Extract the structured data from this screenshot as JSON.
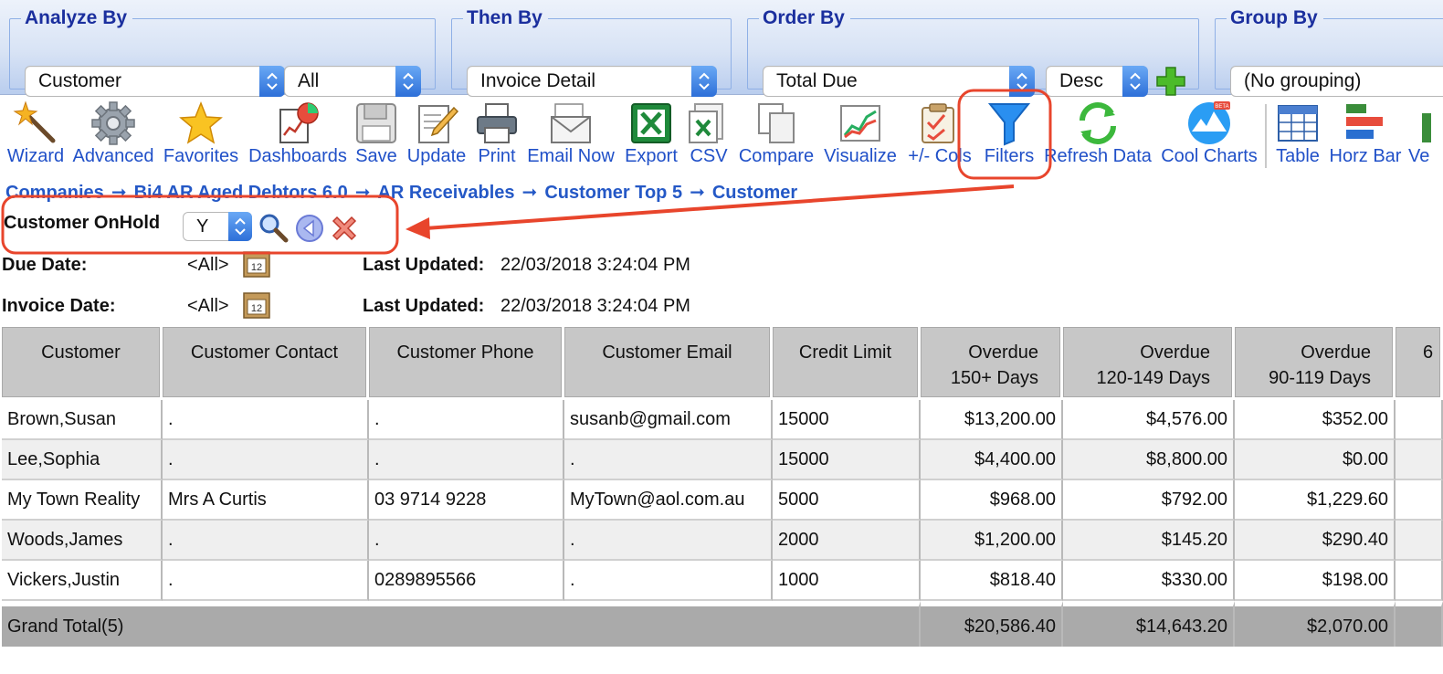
{
  "analyze_bar": {
    "analyze_by": {
      "label": "Analyze By",
      "value": "Customer",
      "scope": "All"
    },
    "then_by": {
      "label": "Then By",
      "value": "Invoice Detail"
    },
    "order_by": {
      "label": "Order By",
      "value": "Total Due",
      "direction": "Desc"
    },
    "group_by": {
      "label": "Group By",
      "value": "(No grouping)"
    }
  },
  "toolbar": [
    {
      "label": "Wizard",
      "icon": "wand-icon"
    },
    {
      "label": "Advanced",
      "icon": "gear-icon"
    },
    {
      "label": "Favorites",
      "icon": "star-icon"
    },
    {
      "label": "Dashboards",
      "icon": "dashboard-icon"
    },
    {
      "label": "Save",
      "icon": "floppy-icon"
    },
    {
      "label": "Update",
      "icon": "pencil-paper-icon"
    },
    {
      "label": "Print",
      "icon": "printer-icon"
    },
    {
      "label": "Email Now",
      "icon": "envelope-icon"
    },
    {
      "label": "Export",
      "icon": "excel-icon"
    },
    {
      "label": "CSV",
      "icon": "csv-icon"
    },
    {
      "label": "Compare",
      "icon": "compare-icon"
    },
    {
      "label": "Visualize",
      "icon": "line-chart-icon"
    },
    {
      "label": "+/- Cols",
      "icon": "clipboard-check-icon"
    },
    {
      "label": "Filters",
      "icon": "funnel-icon"
    },
    {
      "label": "Refresh Data",
      "icon": "refresh-icon"
    },
    {
      "label": "Cool Charts",
      "icon": "cool-charts-icon"
    },
    {
      "label": "Table",
      "icon": "table-icon"
    },
    {
      "label": "Horz Bar",
      "icon": "horizontal-bar-icon"
    },
    {
      "label": "Ve",
      "icon": "vertical-bar-icon"
    }
  ],
  "cool_charts_badge": "BETA",
  "breadcrumb": [
    "Companies",
    "Bi4 AR Aged Debtors 6.0",
    "AR Receivables",
    "Customer Top 5",
    "Customer"
  ],
  "filter": {
    "label": "Customer OnHold",
    "value": "Y"
  },
  "dates": [
    {
      "label": "Due Date:",
      "value": "<All>",
      "calendar_text": "12",
      "updated_label": "Last Updated:",
      "updated_value": "22/03/2018 3:24:04 PM"
    },
    {
      "label": "Invoice Date:",
      "value": "<All>",
      "calendar_text": "12",
      "updated_label": "Last Updated:",
      "updated_value": "22/03/2018 3:24:04 PM"
    }
  ],
  "grid": {
    "columns": [
      [
        "Customer"
      ],
      [
        "Customer Contact"
      ],
      [
        "Customer Phone"
      ],
      [
        "Customer Email"
      ],
      [
        "Credit Limit"
      ],
      [
        "Overdue",
        "150+ Days"
      ],
      [
        "Overdue",
        "120-149 Days"
      ],
      [
        "Overdue",
        "90-119 Days"
      ],
      [
        "6"
      ]
    ],
    "rows": [
      [
        "Brown,Susan",
        ".",
        ".",
        "susanb@gmail.com",
        "15000",
        "$13,200.00",
        "$4,576.00",
        "$352.00",
        ""
      ],
      [
        "Lee,Sophia",
        ".",
        ".",
        ".",
        "15000",
        "$4,400.00",
        "$8,800.00",
        "$0.00",
        ""
      ],
      [
        "My Town Reality",
        "Mrs A Curtis",
        "03 9714 9228",
        "MyTown@aol.com.au",
        "5000",
        "$968.00",
        "$792.00",
        "$1,229.60",
        ""
      ],
      [
        "Woods,James",
        ".",
        ".",
        ".",
        "2000",
        "$1,200.00",
        "$145.20",
        "$290.40",
        ""
      ],
      [
        "Vickers,Justin",
        ".",
        "0289895566",
        ".",
        "1000",
        "$818.40",
        "$330.00",
        "$198.00",
        ""
      ]
    ],
    "total": {
      "label": "Grand Total(5)",
      "values": [
        "$20,586.40",
        "$14,643.20",
        "$2,070.00"
      ]
    }
  },
  "colors": {
    "annotation": "#e8452c",
    "link_blue": "#2458c6",
    "header_gray": "#c7c7c7",
    "total_gray": "#aaaaaa"
  }
}
